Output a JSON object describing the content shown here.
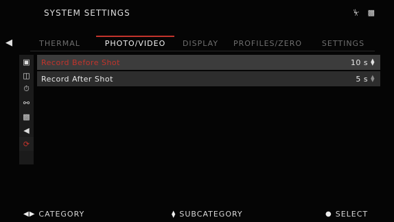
{
  "header": {
    "title": "SYSTEM SETTINGS",
    "status_icons": [
      "power-plug-icon",
      "sd-card-icon"
    ]
  },
  "tabs": [
    {
      "label": "THERMAL",
      "active": false
    },
    {
      "label": "PHOTO/VIDEO",
      "active": true
    },
    {
      "label": "DISPLAY",
      "active": false
    },
    {
      "label": "PROFILES/ZERO",
      "active": false
    },
    {
      "label": "SETTINGS",
      "active": false
    }
  ],
  "sidebar": {
    "items": [
      {
        "icon": "camera-icon"
      },
      {
        "icon": "gallery-icon"
      },
      {
        "icon": "timer-icon"
      },
      {
        "icon": "microphone-icon"
      },
      {
        "icon": "clapperboard-icon"
      },
      {
        "icon": "speaker-icon"
      },
      {
        "icon": "recoil-record-icon",
        "active": true
      }
    ]
  },
  "settings": [
    {
      "label": "Record Before Shot",
      "value": "10 s",
      "selected": true
    },
    {
      "label": "Record After Shot",
      "value": "5 s",
      "selected": false
    }
  ],
  "footer": {
    "category": "CATEGORY",
    "subcategory": "SUBCATEGORY",
    "select": "SELECT"
  },
  "colors": {
    "accent": "#c4342c",
    "row_bg": "#2d2d2d",
    "row_selected_bg": "#3c3c3c",
    "inactive_text": "#6f6f6f"
  }
}
